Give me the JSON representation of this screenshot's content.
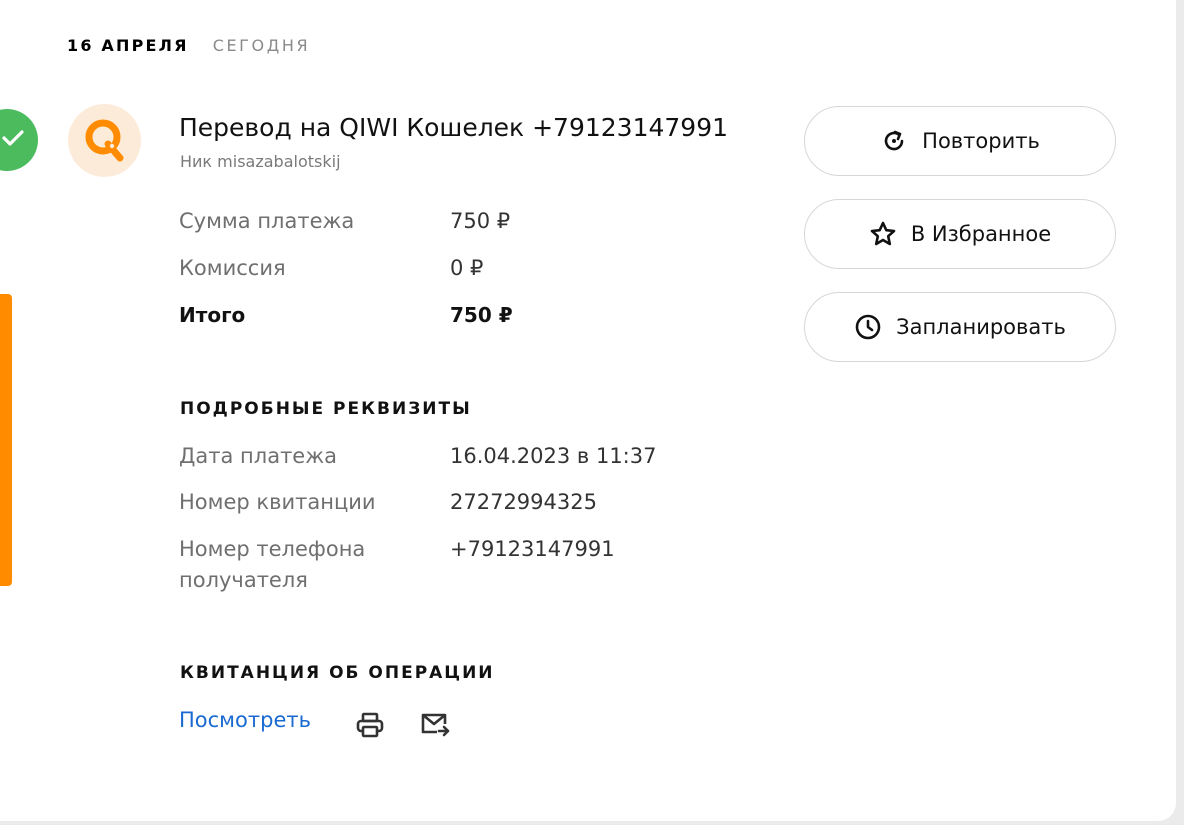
{
  "header": {
    "date": "16 АПРЕЛЯ",
    "relative": "СЕГОДНЯ"
  },
  "payment": {
    "title": "Перевод на QIWI Кошелек +79123147991",
    "nick": "Ник misazabalotskij",
    "status_icon": "check-icon",
    "logo_icon": "qiwi-logo-icon"
  },
  "amounts": [
    {
      "label": "Сумма платежа",
      "value": "750 ₽"
    },
    {
      "label": "Комиссия",
      "value": "0 ₽"
    },
    {
      "label": "Итого",
      "value": "750 ₽"
    }
  ],
  "details": {
    "title": "ПОДРОБНЫЕ РЕКВИЗИТЫ",
    "rows": [
      {
        "label": "Дата платежа",
        "value": "16.04.2023 в 11:37"
      },
      {
        "label": "Номер квитанции",
        "value": "27272994325"
      },
      {
        "label": "Номер телефона получателя",
        "value": "+79123147991"
      }
    ]
  },
  "receipt": {
    "title": "КВИТАНЦИЯ ОБ ОПЕРАЦИИ",
    "view_label": "Посмотреть",
    "print_icon": "print-icon",
    "email_icon": "email-forward-icon"
  },
  "actions": {
    "repeat": "Повторить",
    "favorite": "В Избранное",
    "schedule": "Запланировать"
  },
  "colors": {
    "success": "#4cbb5e",
    "accent": "#ff8c00",
    "link": "#1a6ad1"
  }
}
